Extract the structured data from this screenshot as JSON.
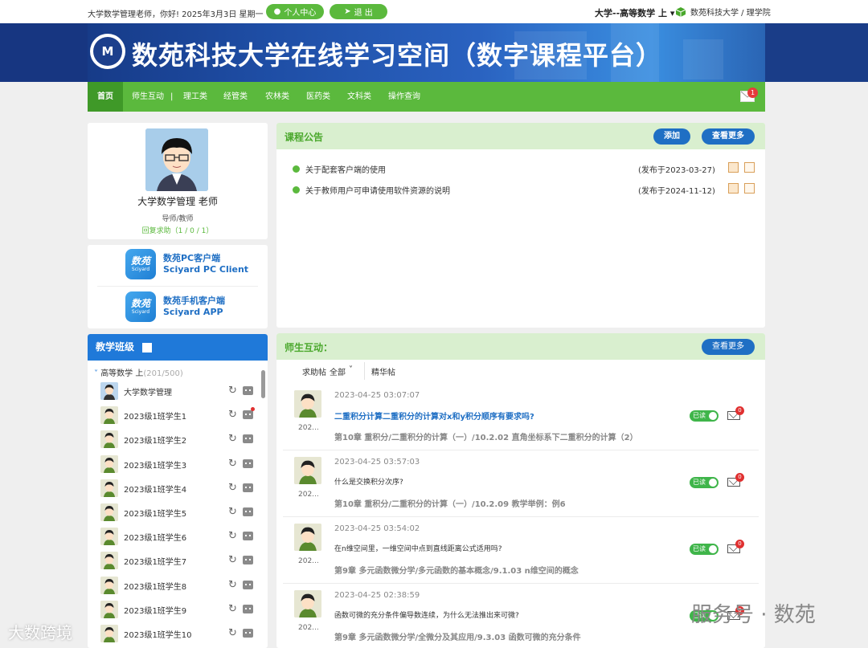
{
  "topbar": {
    "greeting": "大学数学管理老师，你好!  2025年3月3日 星期一",
    "profile_btn": "个人中心",
    "logout_btn": "退 出",
    "course": "大学--高等数学 上",
    "university": "数苑科技大学 / 理学院"
  },
  "banner": {
    "title": "数苑科技大学在线学习空间（数字课程平台）",
    "logo_text": "M"
  },
  "nav": {
    "items": [
      "首页",
      "师生互动",
      "|",
      "理工类",
      "经管类",
      "农林类",
      "医药类",
      "文科类",
      "操作查询"
    ],
    "mail_badge": "1"
  },
  "profile": {
    "name": "大学数学管理 老师",
    "role": "导师/教师",
    "answer_stats": "回复求助（1 / 0 / 1）"
  },
  "clients": [
    {
      "icon": "数苑",
      "icon_sub": "Sciyard",
      "line1": "数苑PC客户端",
      "line2": "Sciyard  PC  Client"
    },
    {
      "icon": "数苑",
      "icon_sub": "Sciyard",
      "line1": "数苑手机客户端",
      "line2": "Sciyard  APP"
    }
  ],
  "classes": {
    "title": "教学班级",
    "group_name": "高等数学 上",
    "group_count": "(201/500)",
    "students": [
      "大学数学管理",
      "2023级1班学生1",
      "2023级1班学生2",
      "2023级1班学生3",
      "2023级1班学生4",
      "2023级1班学生5",
      "2023级1班学生6",
      "2023级1班学生7",
      "2023级1班学生8",
      "2023级1班学生9",
      "2023级1班学生10"
    ]
  },
  "announcements": {
    "title": "课程公告",
    "add_btn": "添加",
    "more_btn": "查看更多",
    "items": [
      {
        "title": "关于配套客户端的使用",
        "date": "(发布于2023-03-27)"
      },
      {
        "title": "关于教师用户可申请使用软件资源的说明",
        "date": "(发布于2024-11-12)"
      }
    ]
  },
  "interaction": {
    "title": "师生互动：",
    "more_btn": "查看更多",
    "tab_help": "求助帖",
    "tab_filter": "全部",
    "tab_best": "精华帖",
    "posts": [
      {
        "time": "2023-04-25 03:07:07",
        "question": "二重积分计算二重积分的计算对x和y积分顺序有要求吗?",
        "chapter": "第10章 重积分/二重积分的计算（一）/10.2.02 直角坐标系下二重积分的计算（2）",
        "user": "202...",
        "read": "已读",
        "badge": "0"
      },
      {
        "time": "2023-04-25 03:57:03",
        "question": "什么是交换积分次序?",
        "chapter": "第10章 重积分/二重积分的计算（一）/10.2.09 教学举例：例6",
        "user": "202...",
        "read": "已读",
        "badge": "0"
      },
      {
        "time": "2023-04-25 03:54:02",
        "question": "在n维空间里，一维空间中点到直线距离公式适用吗?",
        "chapter": "第9章 多元函数微分学/多元函数的基本概念/9.1.03 n维空间的概念",
        "user": "202...",
        "read": "已读",
        "badge": "0"
      },
      {
        "time": "2023-04-25 02:38:59",
        "question": "函数可微的充分条件偏导数连续，为什么无法推出来可微?",
        "chapter": "第9章 多元函数微分学/全微分及其应用/9.3.03 函数可微的充分条件",
        "user": "202...",
        "read": "已读",
        "badge": "0"
      }
    ]
  },
  "watermarks": {
    "left": "大数跨境",
    "right": "服务号 · 数苑"
  }
}
